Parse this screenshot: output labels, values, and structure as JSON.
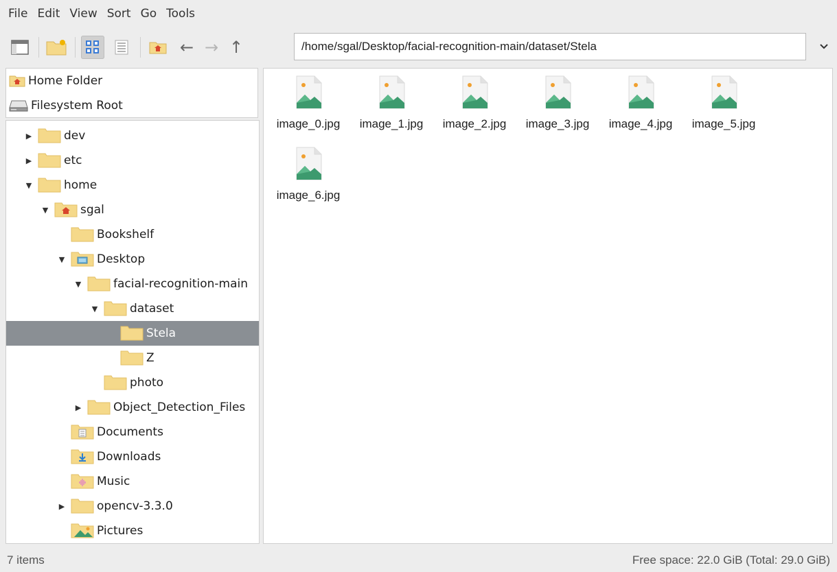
{
  "menubar": {
    "items": [
      "File",
      "Edit",
      "View",
      "Sort",
      "Go",
      "Tools"
    ]
  },
  "toolbar": {
    "buttons": [
      "new-window-icon",
      "new-folder-icon",
      "icon-view-icon",
      "list-view-icon",
      "home-icon"
    ],
    "path": "/home/sgal/Desktop/facial-recognition-main/dataset/Stela"
  },
  "places": [
    {
      "label": "Home Folder",
      "icon": "home-folder-icon"
    },
    {
      "label": "Filesystem Root",
      "icon": "drive-icon"
    }
  ],
  "tree": [
    {
      "label": "dev",
      "depth": 0,
      "expander": "collapsed",
      "icon": "folder"
    },
    {
      "label": "etc",
      "depth": 0,
      "expander": "collapsed",
      "icon": "folder"
    },
    {
      "label": "home",
      "depth": 0,
      "expander": "expanded",
      "icon": "folder"
    },
    {
      "label": "sgal",
      "depth": 1,
      "expander": "expanded",
      "icon": "home-folder"
    },
    {
      "label": "Bookshelf",
      "depth": 2,
      "expander": "none",
      "icon": "folder"
    },
    {
      "label": "Desktop",
      "depth": 2,
      "expander": "expanded",
      "icon": "desktop-folder"
    },
    {
      "label": "facial-recognition-main",
      "depth": 3,
      "expander": "expanded",
      "icon": "folder"
    },
    {
      "label": "dataset",
      "depth": 4,
      "expander": "expanded",
      "icon": "folder"
    },
    {
      "label": "Stela",
      "depth": 5,
      "expander": "none",
      "icon": "folder",
      "selected": true
    },
    {
      "label": "Z",
      "depth": 5,
      "expander": "none",
      "icon": "folder"
    },
    {
      "label": "photo",
      "depth": 4,
      "expander": "none",
      "icon": "folder"
    },
    {
      "label": "Object_Detection_Files",
      "depth": 3,
      "expander": "collapsed",
      "icon": "folder"
    },
    {
      "label": "Documents",
      "depth": 2,
      "expander": "none",
      "icon": "documents-folder"
    },
    {
      "label": "Downloads",
      "depth": 2,
      "expander": "none",
      "icon": "downloads-folder"
    },
    {
      "label": "Music",
      "depth": 2,
      "expander": "none",
      "icon": "music-folder"
    },
    {
      "label": "opencv-3.3.0",
      "depth": 2,
      "expander": "collapsed",
      "icon": "folder"
    },
    {
      "label": "Pictures",
      "depth": 2,
      "expander": "none",
      "icon": "pictures-folder"
    }
  ],
  "files": [
    "image_0.jpg",
    "image_1.jpg",
    "image_2.jpg",
    "image_3.jpg",
    "image_4.jpg",
    "image_5.jpg",
    "image_6.jpg"
  ],
  "statusbar": {
    "count": "7 items",
    "space": "Free space: 22.0 GiB (Total: 29.0 GiB)"
  },
  "colors": {
    "selection": "#8a8f94",
    "folder": "#f5d98a",
    "image_green": "#3d9a6e",
    "home_red": "#d8452c"
  }
}
